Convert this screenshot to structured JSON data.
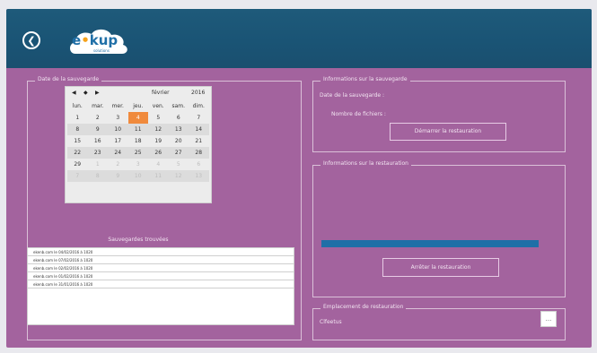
{
  "header": {
    "back_icon": "arrow-left-icon",
    "logo_prefix": "e",
    "logo_dot": "•",
    "logo_suffix": "kup",
    "logo_sub": "solutions"
  },
  "left_panel": {
    "legend": "Date de la sauvegarde",
    "calendar": {
      "nav": [
        "◀",
        "◆",
        "▶"
      ],
      "month": "février",
      "year": "2016",
      "weekdays": [
        "lun.",
        "mar.",
        "mer.",
        "jeu.",
        "ven.",
        "sam.",
        "dim."
      ],
      "weeks": [
        [
          "1",
          "2",
          "3",
          "4",
          "5",
          "6",
          "7"
        ],
        [
          "8",
          "9",
          "10",
          "11",
          "12",
          "13",
          "14"
        ],
        [
          "15",
          "16",
          "17",
          "18",
          "19",
          "20",
          "21"
        ],
        [
          "22",
          "23",
          "24",
          "25",
          "26",
          "27",
          "28"
        ],
        [
          "29",
          "1",
          "2",
          "3",
          "4",
          "5",
          "6"
        ],
        [
          "7",
          "8",
          "9",
          "10",
          "11",
          "12",
          "13"
        ]
      ],
      "selected": "4"
    },
    "found_title": "Sauvegardes trouvées",
    "backups": [
      "ekenb.com le 04/02/2016 à 1020",
      "ekenb.com le 07/02/2016 à 1020",
      "ekenb.com le 02/02/2016 à 1020",
      "ekenb.com le 01/02/2016 à 1020",
      "ekenb.com le 31/01/2016 à 1020"
    ]
  },
  "info_save": {
    "legend": "Informations sur la sauvegarde",
    "date_label": "Date de la sauvegarde :",
    "files_label": "Nombre de fichiers :",
    "start_button": "Démarrer la restauration"
  },
  "info_restore": {
    "legend": "Informations sur la restauration",
    "progress": 1.0,
    "stop_button": "Arrêter la restauration"
  },
  "location": {
    "legend": "Emplacement de restauration",
    "value": "Clfeetus",
    "browse_label": "..."
  },
  "colors": {
    "window_bg": "#a3639e",
    "header_bg": "#1a5475",
    "accent": "#f08a3c",
    "progress": "#1f6fa7"
  }
}
